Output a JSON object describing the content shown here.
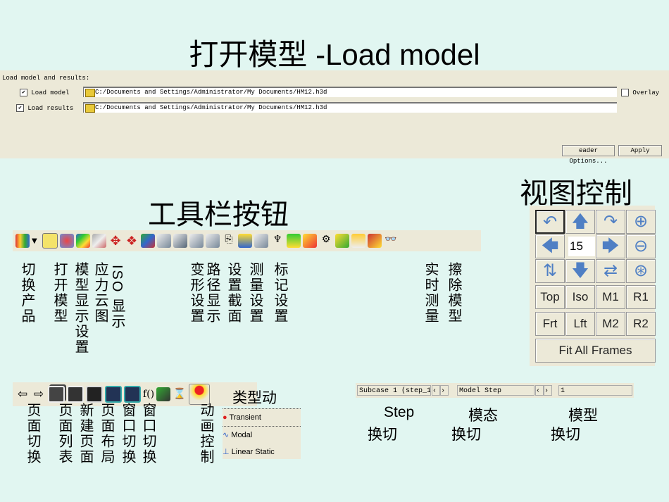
{
  "title": "打开模型 -Load model",
  "load_panel": {
    "heading": "Load model and results:",
    "load_model_label": "Load model",
    "load_model_checked": true,
    "load_model_path": "C:/Documents and Settings/Administrator/My Documents/HM12.h3d",
    "overlay_label": "Overlay",
    "overlay_checked": false,
    "load_results_label": "Load results",
    "load_results_checked": true,
    "load_results_path": "C:/Documents and Settings/Administrator/My Documents/HM12.h3d",
    "reader_options_label": "eader Options...",
    "apply_label": "Apply"
  },
  "toolbar_heading": "工具栏按钮",
  "toolbar_labels": [
    "切换产品",
    "打开模型",
    "模型显示设置",
    "应力云图",
    "ISO 显示",
    "变形设置",
    "路径显示",
    "设置截面",
    "测量设置",
    "标记设置",
    "实时测量",
    "擦除模型"
  ],
  "view_control": {
    "heading": "视图控制",
    "angle_value": "15",
    "buttons": [
      "Top",
      "Iso",
      "M1",
      "R1",
      "Frt",
      "Lft",
      "M2",
      "R2"
    ],
    "fit_all_label": "Fit All Frames"
  },
  "page_toolbar": {
    "overlay_text": "类型动",
    "labels": [
      "页面切换",
      "页面列表",
      "新建页面",
      "页面布局",
      "窗口切换",
      "窗口切换",
      "动画控制"
    ],
    "fx_label": "f()",
    "animation_menu": [
      "Transient",
      "Modal",
      "Linear Static"
    ]
  },
  "step_bar": {
    "subcase": "Subcase 1 (step_1",
    "model_step": "Model Step",
    "step_value": "1",
    "labels": [
      [
        "Step",
        "换切"
      ],
      [
        "模态",
        "换切"
      ],
      [
        "模型",
        "换切"
      ]
    ]
  }
}
